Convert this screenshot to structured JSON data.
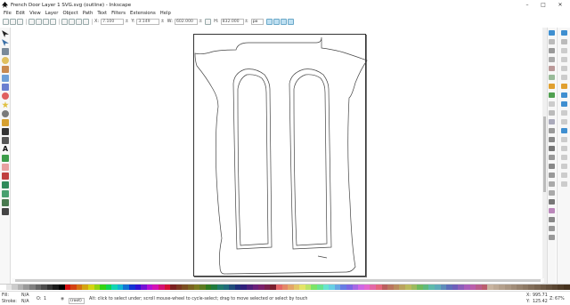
{
  "window": {
    "title": "French Door Layer 1 SVG.svg (outline) - Inkscape",
    "controls": [
      "–",
      "□",
      "✕"
    ]
  },
  "menu": [
    "File",
    "Edit",
    "View",
    "Layer",
    "Object",
    "Path",
    "Text",
    "Filters",
    "Extensions",
    "Help"
  ],
  "tool_controls": {
    "x_label": "X:",
    "x_value": "7.100",
    "y_label": "Y:",
    "y_value": "3.149",
    "w_label": "W:",
    "w_value": "602.000",
    "h_label": "H:",
    "h_value": "832.000",
    "unit": "px"
  },
  "status": {
    "fill_label": "Fill:",
    "fill_value": "N/A",
    "stroke_label": "Stroke:",
    "stroke_value": "N/A",
    "opacity_label": "O:",
    "opacity_value": "1",
    "layer_value": "(root)",
    "message": "Alt: click to select under; scroll mouse-wheel to cycle-select; drag to move selected or select by touch",
    "cursor_x": "995.71",
    "cursor_y": "125.42",
    "zoom": "67%"
  },
  "colors": {
    "accent": "#3f8fd0",
    "page_border": "#333333"
  }
}
